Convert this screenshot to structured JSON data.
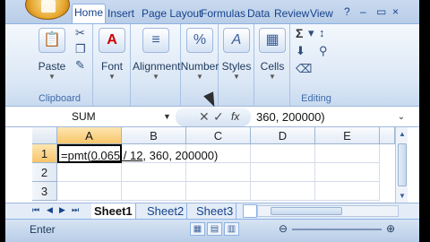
{
  "ribbon_tabs": [
    "Home",
    "Insert",
    "Page Layout",
    "Formulas",
    "Data",
    "Review",
    "View"
  ],
  "window_controls": {
    "minimize": "–",
    "restore": "▭",
    "close": "×"
  },
  "groups": {
    "clipboard": {
      "label": "Clipboard",
      "paste": "Paste"
    },
    "font": {
      "label": "Font"
    },
    "alignment": {
      "label": "Alignment"
    },
    "number": {
      "label": "Number",
      "icon_text": "%"
    },
    "styles": {
      "label": "Styles"
    },
    "cells": {
      "label": "Cells"
    },
    "editing": {
      "label": "Editing",
      "sum": "Σ"
    }
  },
  "formula_bar": {
    "name_box": "SUM",
    "cancel": "✕",
    "enter": "✓",
    "fx": "fx",
    "content": "360, 200000)"
  },
  "grid": {
    "columns": [
      "A",
      "B",
      "C",
      "D",
      "E"
    ],
    "rows": [
      "1",
      "2",
      "3"
    ],
    "active_cell": "A1",
    "cells": {
      "A1_formula_fn": "=pmt(",
      "A1_formula_args": "0.065 / 12",
      "A1_formula_rest": ", 360, 200000)"
    }
  },
  "sheets": [
    "Sheet1",
    "Sheet2",
    "Sheet3"
  ],
  "active_sheet": "Sheet1",
  "status": {
    "mode": "Enter"
  }
}
